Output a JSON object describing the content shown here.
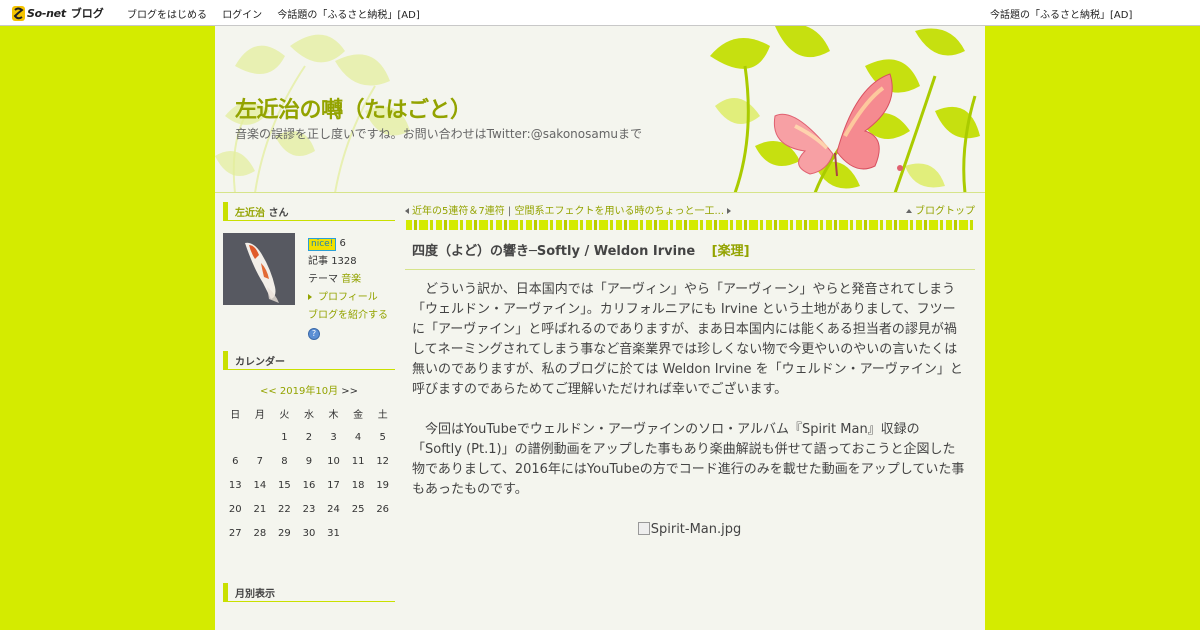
{
  "topbar": {
    "logo_text": "So-net",
    "logo_blog": "ブログ",
    "nav": [
      "ブログをはじめる",
      "ログイン",
      "今話題の「ふるさと納税」[AD]"
    ],
    "right_link": "今話題の「ふるさと納税」[AD]"
  },
  "header": {
    "title": "左近治の囀（たはごと）",
    "description": "音楽の誤謬を正し度いですね。お問い合わせはTwitter:@sakonosamuまで"
  },
  "profile": {
    "heading_name": "左近治",
    "heading_suffix": " さん",
    "nice_label": "nice!",
    "nice_count": "6",
    "articles_label": "記事",
    "articles_count": "1328",
    "theme_label": "テーマ",
    "theme_value": "音楽",
    "profile_link": "プロフィール",
    "introduce_link": "ブログを紹介する",
    "help_icon": "?"
  },
  "calendar": {
    "heading": "カレンダー",
    "prev": "<<",
    "month": "2019年10月",
    "next": ">>",
    "weekdays": [
      "日",
      "月",
      "火",
      "水",
      "木",
      "金",
      "土"
    ],
    "weeks": [
      [
        "",
        "",
        "1",
        "2",
        "3",
        "4",
        "5"
      ],
      [
        "6",
        "7",
        "8",
        "9",
        "10",
        "11",
        "12"
      ],
      [
        "13",
        "14",
        "15",
        "16",
        "17",
        "18",
        "19"
      ],
      [
        "20",
        "21",
        "22",
        "23",
        "24",
        "25",
        "26"
      ],
      [
        "27",
        "28",
        "29",
        "30",
        "31",
        "",
        ""
      ]
    ]
  },
  "monthly": {
    "heading": "月別表示"
  },
  "entry_nav": {
    "prev_link": "近年の5連符＆7連符",
    "separator": "|",
    "next_link": "空間系エフェクトを用いる時のちょっと一工...",
    "top_link": "ブログトップ"
  },
  "entry": {
    "title": "四度（よど）の響き─Softly / Weldon Irvine",
    "category": "[楽理]",
    "paragraphs": [
      "　どういう訳か、日本国内では「アーヴィン」やら「アーヴィーン」やらと発音されてしまう「ウェルドン・アーヴァイン」。カリフォルニアにも Irvine という土地がありまして、フツーに「アーヴァイン」と呼ばれるのでありますが、まあ日本国内には能くある担当者の謬見が禍してネーミングされてしまう事など音楽業界では珍しくない物で今更やいのやいの言いたくは無いのでありますが、私のブログに於ては Weldon Irvine を「ウェルドン・アーヴァイン」と呼びますのであらためてご理解いただければ幸いでございます。",
      "　今回はYouTubeでウェルドン・アーヴァインのソロ・アルバム『Spirit Man』収録の「Softly (Pt.1)」の譜例動画をアップした事もあり楽曲解説も併せて語っておこうと企図した物でありまして、2016年にはYouTubeの方でコード進行のみを載せた動画をアップしていた事もあったものです。"
    ],
    "image_alt": "Spirit-Man.jpg"
  }
}
